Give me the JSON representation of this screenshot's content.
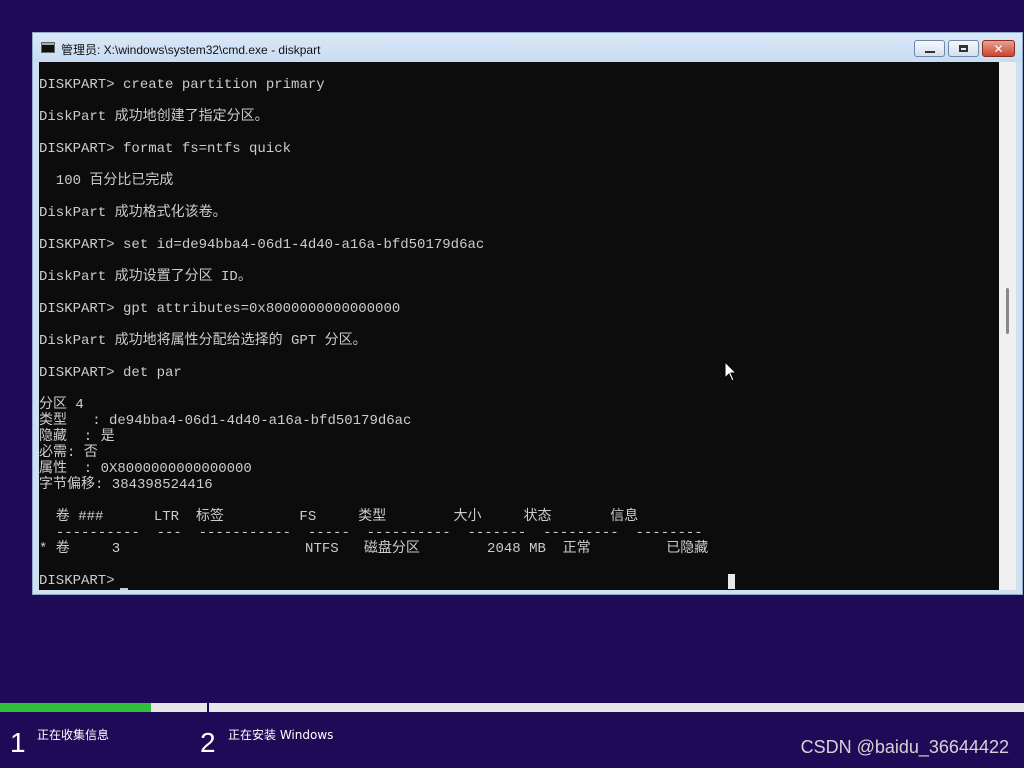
{
  "window": {
    "title": "管理员: X:\\windows\\system32\\cmd.exe - diskpart",
    "minimize_label": "",
    "maximize_label": "",
    "close_label": "✕"
  },
  "console": {
    "lines": [
      "DISKPART> create partition primary",
      "",
      "DiskPart 成功地创建了指定分区。",
      "",
      "DISKPART> format fs=ntfs quick",
      "",
      "  100 百分比已完成",
      "",
      "DiskPart 成功格式化该卷。",
      "",
      "DISKPART> set id=de94bba4-06d1-4d40-a16a-bfd50179d6ac",
      "",
      "DiskPart 成功设置了分区 ID。",
      "",
      "DISKPART> gpt attributes=0x8000000000000000",
      "",
      "DiskPart 成功地将属性分配给选择的 GPT 分区。",
      "",
      "DISKPART> det par",
      "",
      "分区 4",
      "类型   : de94bba4-06d1-4d40-a16a-bfd50179d6ac",
      "隐藏  : 是",
      "必需: 否",
      "属性  : 0X8000000000000000",
      "字节偏移: 384398524416",
      "",
      "  卷 ###      LTR  标签         FS     类型        大小     状态       信息",
      "  ----------  ---  -----------  -----  ----------  -------  ---------  --------",
      "* 卷     3                      NTFS   磁盘分区        2048 MB  正常         已隐藏",
      "",
      "DISKPART> "
    ]
  },
  "installer": {
    "progress_fraction": 0.147,
    "step1_number": "1",
    "step1_label": "正在收集信息",
    "step2_number": "2",
    "step2_label": "正在安装 Windows"
  },
  "watermark": "CSDN @baidu_36644422"
}
